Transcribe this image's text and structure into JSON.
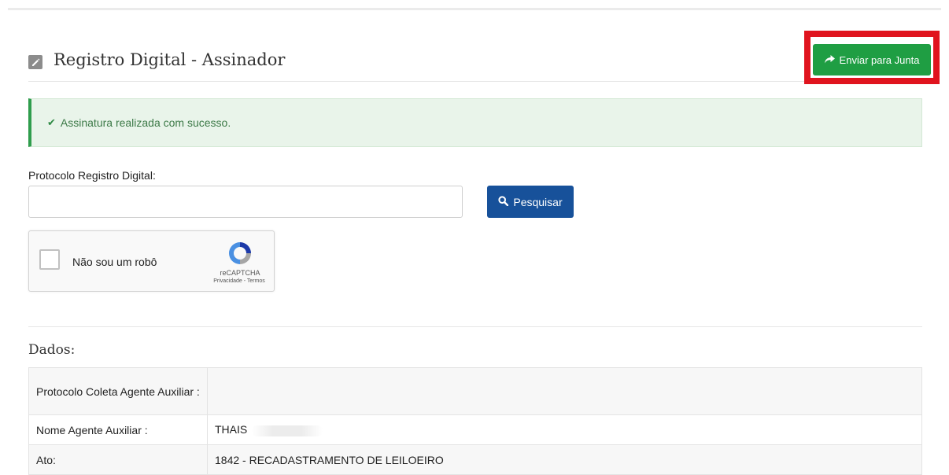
{
  "header": {
    "title": "Registro Digital - Assinador",
    "enviar_label": "Enviar para Junta"
  },
  "alert": {
    "message": "Assinatura realizada com sucesso."
  },
  "search": {
    "label": "Protocolo Registro Digital:",
    "value": "",
    "button_label": "Pesquisar"
  },
  "recaptcha": {
    "label": "Não sou um robô",
    "brand": "reCAPTCHA",
    "links": "Privacidade - Termos"
  },
  "dados": {
    "title": "Dados:",
    "rows": [
      {
        "key": "Protocolo Coleta Agente Auxiliar :",
        "value": ""
      },
      {
        "key": "Nome Agente Auxiliar :",
        "value": "THAIS"
      },
      {
        "key": "Ato:",
        "value": "1842 - RECADASTRAMENTO DE LEILOEIRO"
      }
    ]
  },
  "colors": {
    "success_green": "#1f9e43",
    "primary_blue": "#17519a",
    "highlight_red": "#e0141e"
  },
  "icons": [
    "edit-icon",
    "share-arrow-icon",
    "search-icon",
    "check-icon",
    "recaptcha-logo-icon"
  ]
}
